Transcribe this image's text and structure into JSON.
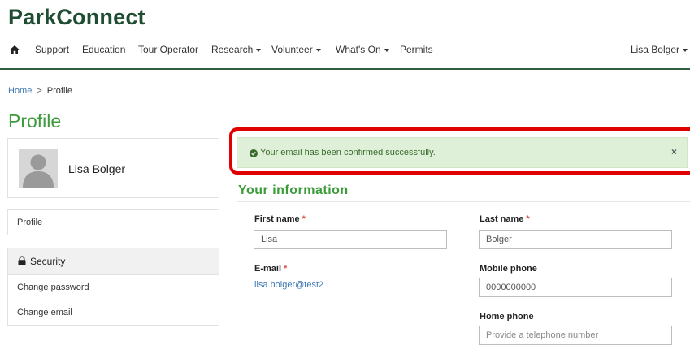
{
  "brand": "ParkConnect",
  "nav": {
    "items": [
      {
        "label": "Support",
        "dropdown": false
      },
      {
        "label": "Education",
        "dropdown": false
      },
      {
        "label": "Tour Operator",
        "dropdown": false
      },
      {
        "label": "Research",
        "dropdown": true
      },
      {
        "label": "Volunteer",
        "dropdown": true
      },
      {
        "label": "What's On",
        "dropdown": true
      },
      {
        "label": "Permits",
        "dropdown": false
      }
    ],
    "user": "Lisa Bolger"
  },
  "breadcrumb": {
    "home": "Home",
    "separator": ">",
    "current": "Profile"
  },
  "page_title": "Profile",
  "profile": {
    "name": "Lisa Bolger"
  },
  "sidebar": {
    "profile_link": "Profile",
    "security_heading": "Security",
    "security_items": [
      "Change password",
      "Change email"
    ]
  },
  "alert": {
    "message": "Your email has been confirmed successfully.",
    "close": "×"
  },
  "section_title": "Your information",
  "form": {
    "first_name": {
      "label": "First name",
      "value": "Lisa"
    },
    "last_name": {
      "label": "Last name",
      "value": "Bolger"
    },
    "email": {
      "label": "E-mail",
      "value": "lisa.bolger@test2"
    },
    "mobile_phone": {
      "label": "Mobile phone",
      "value": "0000000000"
    },
    "home_phone": {
      "label": "Home phone",
      "placeholder": "Provide a telephone number"
    },
    "required_marker": "*"
  },
  "colors": {
    "brand": "#1f4d31",
    "accent_green": "#3c9b3a",
    "link_blue": "#3c78b5",
    "alert_bg": "#dff0d8",
    "highlight_red": "#e10000"
  }
}
